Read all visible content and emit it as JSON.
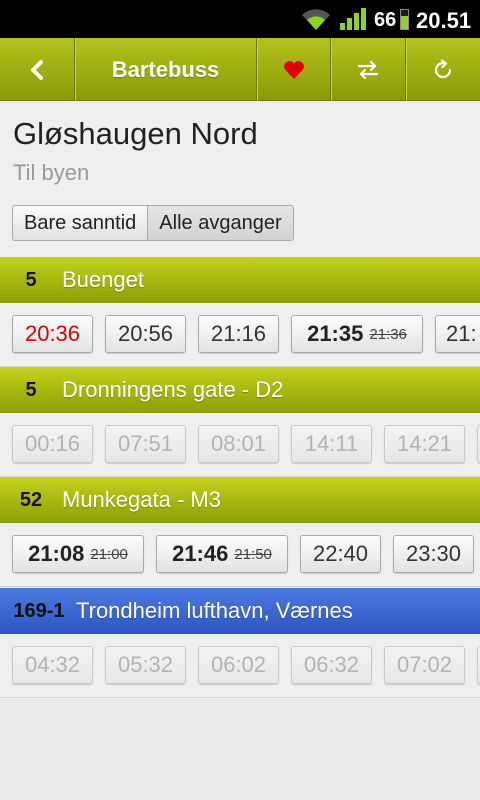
{
  "status_bar": {
    "battery_level": "66",
    "time": "20.51",
    "icons": [
      "wifi-icon",
      "signal-icon",
      "battery-icon"
    ],
    "battery_color": "#8fd21f"
  },
  "action_bar": {
    "title": "Bartebuss",
    "icons": [
      "back-icon",
      "heart-icon",
      "swap-icon",
      "refresh-icon"
    ],
    "color": "#9aab0e",
    "heart_color": "#e00000"
  },
  "stop": {
    "name": "Gløshaugen Nord",
    "direction": "Til byen"
  },
  "toggle": {
    "options": [
      "Bare sanntid",
      "Alle avganger"
    ],
    "selected": "Alle avganger"
  },
  "routes": [
    {
      "number": "5",
      "name": "Buenget",
      "color": "#a4b50f",
      "departures": [
        {
          "time": "20:36",
          "state": "late"
        },
        {
          "time": "20:56",
          "state": "scheduled"
        },
        {
          "time": "21:16",
          "state": "scheduled"
        },
        {
          "time": "21:35",
          "scheduled_time": "21:36",
          "state": "realtime"
        },
        {
          "time": "21:",
          "state": "scheduled"
        }
      ]
    },
    {
      "number": "5",
      "name": "Dronningens gate - D2",
      "color": "#a4b50f",
      "departures": [
        {
          "time": "00:16",
          "state": "inactive"
        },
        {
          "time": "07:51",
          "state": "inactive"
        },
        {
          "time": "08:01",
          "state": "inactive"
        },
        {
          "time": "14:11",
          "state": "inactive"
        },
        {
          "time": "14:21",
          "state": "inactive"
        }
      ]
    },
    {
      "number": "52",
      "name": "Munkegata - M3",
      "color": "#a4b50f",
      "departures": [
        {
          "time": "21:08",
          "scheduled_time": "21:00",
          "state": "realtime"
        },
        {
          "time": "21:46",
          "scheduled_time": "21:50",
          "state": "realtime"
        },
        {
          "time": "22:40",
          "state": "scheduled"
        },
        {
          "time": "23:30",
          "state": "scheduled"
        }
      ]
    },
    {
      "number": "169-1",
      "name": "Trondheim lufthavn, Værnes",
      "color": "#3d66d4",
      "departures": [
        {
          "time": "04:32",
          "state": "inactive"
        },
        {
          "time": "05:32",
          "state": "inactive"
        },
        {
          "time": "06:02",
          "state": "inactive"
        },
        {
          "time": "06:32",
          "state": "inactive"
        },
        {
          "time": "07:02",
          "state": "inactive"
        }
      ]
    }
  ]
}
